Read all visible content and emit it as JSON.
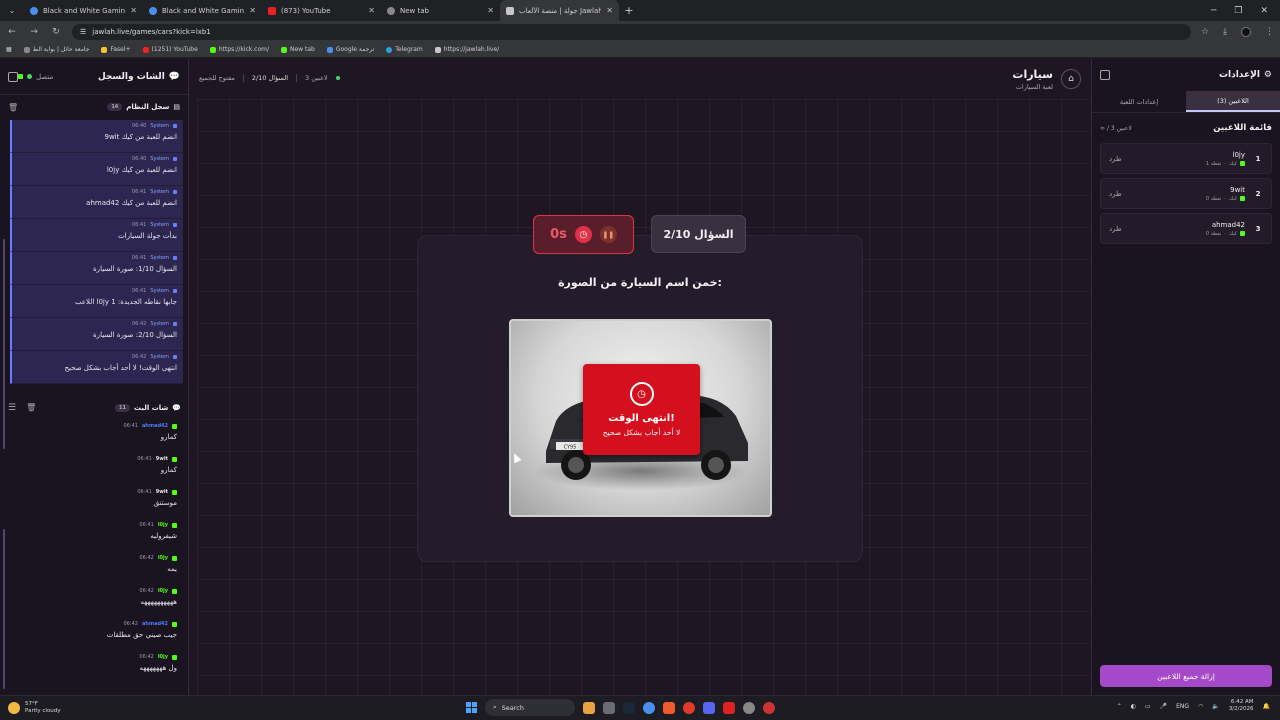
{
  "browser": {
    "tabs": [
      {
        "title": "Black and White Gaming Logo",
        "icon": "globe-icon"
      },
      {
        "title": "Black and White Gaming Logo",
        "icon": "globe-icon"
      },
      {
        "title": "(873) YouTube",
        "icon": "youtube-icon"
      },
      {
        "title": "New tab",
        "icon": "newtab-icon"
      },
      {
        "title": "جولة | منصة الألعاب Jawlah - ال",
        "icon": "jawlah-icon",
        "active": true
      }
    ],
    "url": "jawlah.live/games/cars?kick=lxb1",
    "bookmarks": [
      {
        "label": "جامعة حائل | بوابة الط"
      },
      {
        "label": "Fasel+"
      },
      {
        "label": "(1251) YouTube"
      },
      {
        "label": "https://kick.com/"
      },
      {
        "label": "New tab"
      },
      {
        "label": "Google ترجمة"
      },
      {
        "label": "Telegram"
      },
      {
        "label": "https://jawlah.live/"
      }
    ]
  },
  "left_panel": {
    "title": "الشات والسجل",
    "status": "متصل",
    "system_log": {
      "title": "سجل النظام",
      "count": "14",
      "items": [
        {
          "time": "06:40",
          "sender": "System",
          "msg": "9wit انضم للعبة من كيك"
        },
        {
          "time": "06:40",
          "sender": "System",
          "msg": "l0jy انضم للعبة من كيك"
        },
        {
          "time": "06:41",
          "sender": "System",
          "msg": "ahmad42 انضم للعبة من كيك"
        },
        {
          "time": "06:41",
          "sender": "System",
          "msg": "بدأت جولة السيارات"
        },
        {
          "time": "06:41",
          "sender": "System",
          "msg": "السؤال 1/10: صورة السيارة"
        },
        {
          "time": "06:41",
          "sender": "System",
          "msg": "اللاعب l0jy جابها نقاطه الجديدة: 1"
        },
        {
          "time": "06:42",
          "sender": "System",
          "msg": "السؤال 2/10: صورة السيارة"
        },
        {
          "time": "06:42",
          "sender": "System",
          "msg": "انتهى الوقت! لا أحد أجاب بشكل صحيح"
        }
      ]
    },
    "chat": {
      "title": "شات البث",
      "count": "11",
      "items": [
        {
          "time": "06:41",
          "user": "ahmad42",
          "color": "#4a7dff",
          "msg": "كمارو"
        },
        {
          "time": "06:41",
          "user": "9wit",
          "color": "#e6e6e6",
          "msg": "كمارو"
        },
        {
          "time": "06:41",
          "user": "9wit",
          "color": "#e6e6e6",
          "msg": "موستنق"
        },
        {
          "time": "06:41",
          "user": "l0jy",
          "color": "#53fc18",
          "msg": "شيفروليه"
        },
        {
          "time": "06:42",
          "user": "l0jy",
          "color": "#53fc18",
          "msg": "يمه"
        },
        {
          "time": "06:42",
          "user": "l0jy",
          "color": "#53fc18",
          "msg": "ههههههههههه"
        },
        {
          "time": "06:42",
          "user": "ahmad42",
          "color": "#4a7dff",
          "msg": "جيب صيني حق مطلقات"
        },
        {
          "time": "06:42",
          "user": "l0jy",
          "color": "#53fc18",
          "msg": "ول هههههههه"
        }
      ]
    }
  },
  "header": {
    "game_title": "سيارات",
    "game_subtitle": "لعبة السيارات",
    "players_status": "3 لاعبين",
    "question_status": "السؤال 2/10",
    "open_status": "مفتوح للجميع"
  },
  "game": {
    "timer_value": "0s",
    "question_counter": "السؤال 2/10",
    "question_text": "خمن اسم السيارة من الصورة:",
    "overlay_title": "انتهى الوقت!",
    "overlay_sub": "لا أحد أجاب بشكل صحيح",
    "plate_text": "CY95"
  },
  "right_panel": {
    "title": "الإعدادات",
    "tabs": [
      "اللاعبين (3)",
      "إعدادات اللعبة"
    ],
    "players_title": "قائمة اللاعبين",
    "players_count": "∞ / 3 لاعبين",
    "players": [
      {
        "rank": "1",
        "name": "l0jy",
        "platform": "كيك",
        "points": "1 نقطة",
        "kick_label": "طرد"
      },
      {
        "rank": "2",
        "name": "9wit",
        "platform": "كيك",
        "points": "0 نقطة",
        "kick_label": "طرد"
      },
      {
        "rank": "3",
        "name": "ahmad42",
        "platform": "كيك",
        "points": "0 نقطة",
        "kick_label": "طرد"
      }
    ],
    "remove_all": "إزالة جميع اللاعبين"
  },
  "taskbar": {
    "weather_temp": "57°F",
    "weather_desc": "Partly cloudy",
    "search": "Search",
    "lang": "ENG",
    "time": "6:42 AM",
    "date": "3/2/2026"
  }
}
